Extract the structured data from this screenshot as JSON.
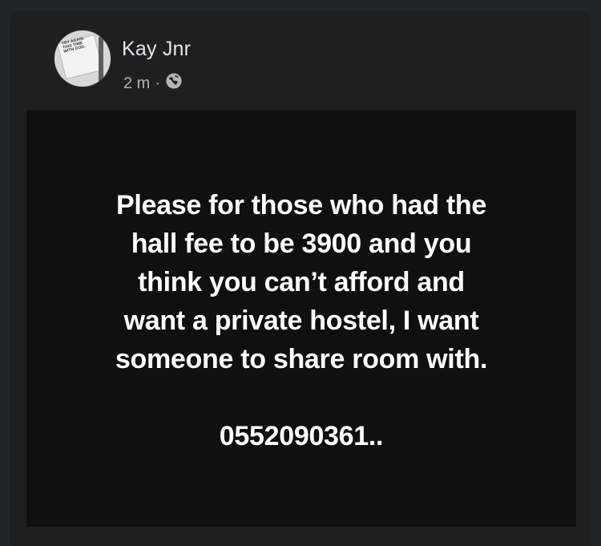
{
  "post": {
    "author_name": "Kay Jnr",
    "avatar_text": "TRY AGAIN. THIS TIME WITH GOD.",
    "time": "2 m",
    "separator": "·",
    "visibility_icon": "globe-icon"
  },
  "image": {
    "lines": [
      "Please for those who had the",
      "hall fee to be 3900 and you",
      "think you can’t afford and",
      "want a private hostel,  I want",
      "someone to share room with."
    ],
    "phone": "0552090361.."
  },
  "colors": {
    "background": "#242526",
    "card": "#1f1f20",
    "image_background": "#101010",
    "text": "#ffffff",
    "secondary_text": "#b0b3b8"
  }
}
